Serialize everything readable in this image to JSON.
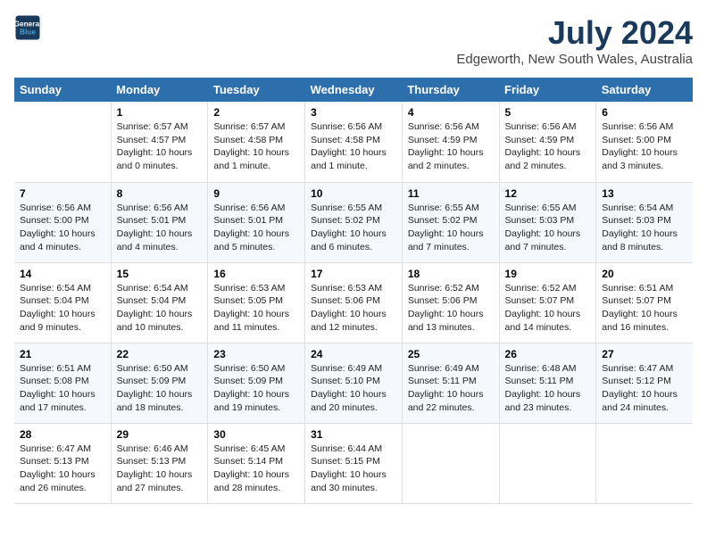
{
  "header": {
    "logo_line1": "General",
    "logo_line2": "Blue",
    "main_title": "July 2024",
    "subtitle": "Edgeworth, New South Wales, Australia"
  },
  "days_of_week": [
    "Sunday",
    "Monday",
    "Tuesday",
    "Wednesday",
    "Thursday",
    "Friday",
    "Saturday"
  ],
  "weeks": [
    [
      {
        "day": "",
        "info": ""
      },
      {
        "day": "1",
        "info": "Sunrise: 6:57 AM\nSunset: 4:57 PM\nDaylight: 10 hours\nand 0 minutes."
      },
      {
        "day": "2",
        "info": "Sunrise: 6:57 AM\nSunset: 4:58 PM\nDaylight: 10 hours\nand 1 minute."
      },
      {
        "day": "3",
        "info": "Sunrise: 6:56 AM\nSunset: 4:58 PM\nDaylight: 10 hours\nand 1 minute."
      },
      {
        "day": "4",
        "info": "Sunrise: 6:56 AM\nSunset: 4:59 PM\nDaylight: 10 hours\nand 2 minutes."
      },
      {
        "day": "5",
        "info": "Sunrise: 6:56 AM\nSunset: 4:59 PM\nDaylight: 10 hours\nand 2 minutes."
      },
      {
        "day": "6",
        "info": "Sunrise: 6:56 AM\nSunset: 5:00 PM\nDaylight: 10 hours\nand 3 minutes."
      }
    ],
    [
      {
        "day": "7",
        "info": "Sunrise: 6:56 AM\nSunset: 5:00 PM\nDaylight: 10 hours\nand 4 minutes."
      },
      {
        "day": "8",
        "info": "Sunrise: 6:56 AM\nSunset: 5:01 PM\nDaylight: 10 hours\nand 4 minutes."
      },
      {
        "day": "9",
        "info": "Sunrise: 6:56 AM\nSunset: 5:01 PM\nDaylight: 10 hours\nand 5 minutes."
      },
      {
        "day": "10",
        "info": "Sunrise: 6:55 AM\nSunset: 5:02 PM\nDaylight: 10 hours\nand 6 minutes."
      },
      {
        "day": "11",
        "info": "Sunrise: 6:55 AM\nSunset: 5:02 PM\nDaylight: 10 hours\nand 7 minutes."
      },
      {
        "day": "12",
        "info": "Sunrise: 6:55 AM\nSunset: 5:03 PM\nDaylight: 10 hours\nand 7 minutes."
      },
      {
        "day": "13",
        "info": "Sunrise: 6:54 AM\nSunset: 5:03 PM\nDaylight: 10 hours\nand 8 minutes."
      }
    ],
    [
      {
        "day": "14",
        "info": "Sunrise: 6:54 AM\nSunset: 5:04 PM\nDaylight: 10 hours\nand 9 minutes."
      },
      {
        "day": "15",
        "info": "Sunrise: 6:54 AM\nSunset: 5:04 PM\nDaylight: 10 hours\nand 10 minutes."
      },
      {
        "day": "16",
        "info": "Sunrise: 6:53 AM\nSunset: 5:05 PM\nDaylight: 10 hours\nand 11 minutes."
      },
      {
        "day": "17",
        "info": "Sunrise: 6:53 AM\nSunset: 5:06 PM\nDaylight: 10 hours\nand 12 minutes."
      },
      {
        "day": "18",
        "info": "Sunrise: 6:52 AM\nSunset: 5:06 PM\nDaylight: 10 hours\nand 13 minutes."
      },
      {
        "day": "19",
        "info": "Sunrise: 6:52 AM\nSunset: 5:07 PM\nDaylight: 10 hours\nand 14 minutes."
      },
      {
        "day": "20",
        "info": "Sunrise: 6:51 AM\nSunset: 5:07 PM\nDaylight: 10 hours\nand 16 minutes."
      }
    ],
    [
      {
        "day": "21",
        "info": "Sunrise: 6:51 AM\nSunset: 5:08 PM\nDaylight: 10 hours\nand 17 minutes."
      },
      {
        "day": "22",
        "info": "Sunrise: 6:50 AM\nSunset: 5:09 PM\nDaylight: 10 hours\nand 18 minutes."
      },
      {
        "day": "23",
        "info": "Sunrise: 6:50 AM\nSunset: 5:09 PM\nDaylight: 10 hours\nand 19 minutes."
      },
      {
        "day": "24",
        "info": "Sunrise: 6:49 AM\nSunset: 5:10 PM\nDaylight: 10 hours\nand 20 minutes."
      },
      {
        "day": "25",
        "info": "Sunrise: 6:49 AM\nSunset: 5:11 PM\nDaylight: 10 hours\nand 22 minutes."
      },
      {
        "day": "26",
        "info": "Sunrise: 6:48 AM\nSunset: 5:11 PM\nDaylight: 10 hours\nand 23 minutes."
      },
      {
        "day": "27",
        "info": "Sunrise: 6:47 AM\nSunset: 5:12 PM\nDaylight: 10 hours\nand 24 minutes."
      }
    ],
    [
      {
        "day": "28",
        "info": "Sunrise: 6:47 AM\nSunset: 5:13 PM\nDaylight: 10 hours\nand 26 minutes."
      },
      {
        "day": "29",
        "info": "Sunrise: 6:46 AM\nSunset: 5:13 PM\nDaylight: 10 hours\nand 27 minutes."
      },
      {
        "day": "30",
        "info": "Sunrise: 6:45 AM\nSunset: 5:14 PM\nDaylight: 10 hours\nand 28 minutes."
      },
      {
        "day": "31",
        "info": "Sunrise: 6:44 AM\nSunset: 5:15 PM\nDaylight: 10 hours\nand 30 minutes."
      },
      {
        "day": "",
        "info": ""
      },
      {
        "day": "",
        "info": ""
      },
      {
        "day": "",
        "info": ""
      }
    ]
  ]
}
